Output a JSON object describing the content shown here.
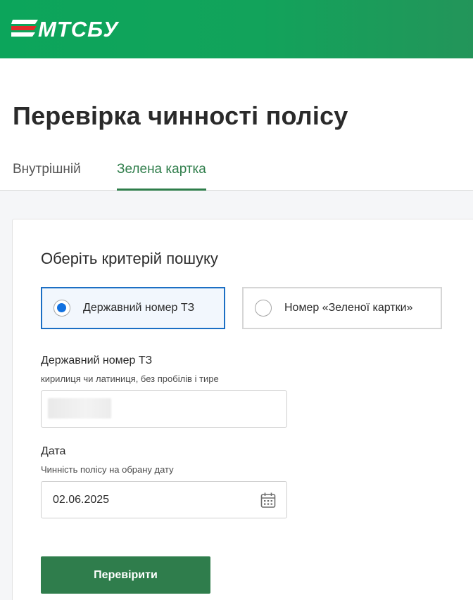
{
  "header": {
    "logo_text": "МТСБУ",
    "logo_icon": "mtsbu-logo-icon",
    "colors": {
      "green": "#12a35b",
      "logo_red": "#e32a2a"
    }
  },
  "page": {
    "title": "Перевірка чинності полісу"
  },
  "tabs": [
    {
      "label": "Внутрішній",
      "active": false
    },
    {
      "label": "Зелена картка",
      "active": true
    }
  ],
  "form": {
    "section_title": "Оберіть критерій пошуку",
    "criteria": [
      {
        "label": "Державний номер ТЗ",
        "selected": true
      },
      {
        "label": "Номер «Зеленої картки»",
        "selected": false
      }
    ],
    "plate": {
      "label": "Державний номер ТЗ",
      "hint": "кирилиця чи латиниця, без пробілів і тире",
      "value": ""
    },
    "date": {
      "label": "Дата",
      "hint": "Чинність полісу на обрану дату",
      "value": "02.06.2025",
      "icon": "calendar-icon"
    },
    "submit_label": "Перевірити"
  },
  "accent": {
    "primary_green": "#2f7d4c",
    "selected_blue": "#1c6fc4"
  }
}
